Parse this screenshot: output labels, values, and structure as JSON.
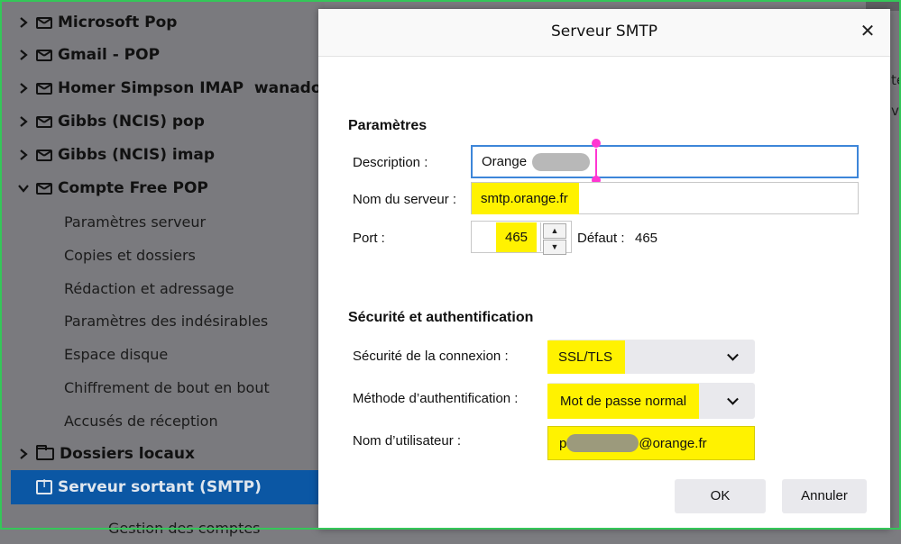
{
  "sidebar": {
    "accounts": [
      {
        "label": "Microsoft Pop",
        "expanded": false
      },
      {
        "label": "Gmail - POP",
        "expanded": false
      },
      {
        "label": "Homer Simpson IMAP  wanadoo",
        "expanded": false
      },
      {
        "label": "Gibbs (NCIS) pop",
        "expanded": false
      },
      {
        "label": "Gibbs (NCIS) imap",
        "expanded": false
      },
      {
        "label": "Compte Free POP",
        "expanded": true
      }
    ],
    "subitems": [
      "Paramètres serveur",
      "Copies et dossiers",
      "Rédaction et adressage",
      "Paramètres des indésirables",
      "Espace disque",
      "Chiffrement de bout en bout",
      "Accusés de réception"
    ],
    "local_folders": "Dossiers locaux",
    "outgoing_server": "Serveur sortant (SMTP)",
    "manage_accounts": "Gestion des comptes"
  },
  "background_right": [
    "te",
    "ve"
  ],
  "dialog": {
    "title": "Serveur SMTP",
    "close_glyph": "✕",
    "settings": {
      "heading": "Paramètres",
      "description_label": "Description :",
      "description_value": "Orange",
      "server_label": "Nom du serveur :",
      "server_value": "smtp.orange.fr",
      "port_label": "Port :",
      "port_value": "465",
      "default_label": "Défaut :",
      "default_value": "465"
    },
    "security": {
      "heading": "Sécurité et authentification",
      "connection_label": "Sécurité de la connexion :",
      "connection_value": "SSL/TLS",
      "auth_label": "Méthode d’authentification :",
      "auth_value": "Mot de passe normal",
      "username_label": "Nom d’utilisateur :",
      "username_prefix": "p",
      "username_suffix": "@orange.fr"
    },
    "ok_label": "OK",
    "cancel_label": "Annuler"
  },
  "colors": {
    "highlight": "#fff200",
    "selection": "#0b57a4",
    "focus_ring": "#3d86d9",
    "caret_marker": "#ff36d2",
    "frame": "#34c759"
  }
}
